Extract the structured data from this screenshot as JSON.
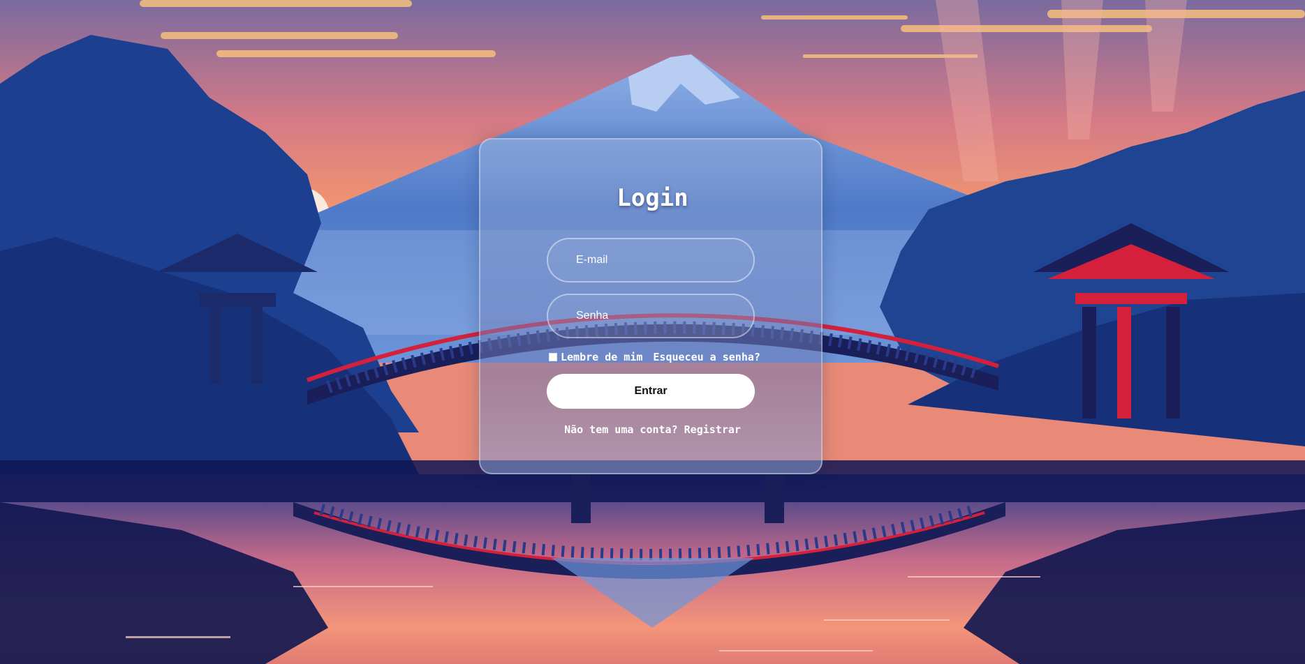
{
  "login": {
    "title": "Login",
    "email_placeholder": "E-mail",
    "password_placeholder": "Senha",
    "remember_label": "Lembre de mim",
    "forgot_label": "Esqueceu a senha?",
    "submit_label": "Entrar",
    "register_prompt": "Não tem uma conta?",
    "register_label": "Registrar"
  },
  "theme": {
    "sky_top": "#7a6a9e",
    "sky_glow": "#f2966f",
    "water_dark": "#14195a",
    "forest": "#1d3f8f",
    "pagoda_red": "#d4203a",
    "button_bg": "#ffffff"
  }
}
